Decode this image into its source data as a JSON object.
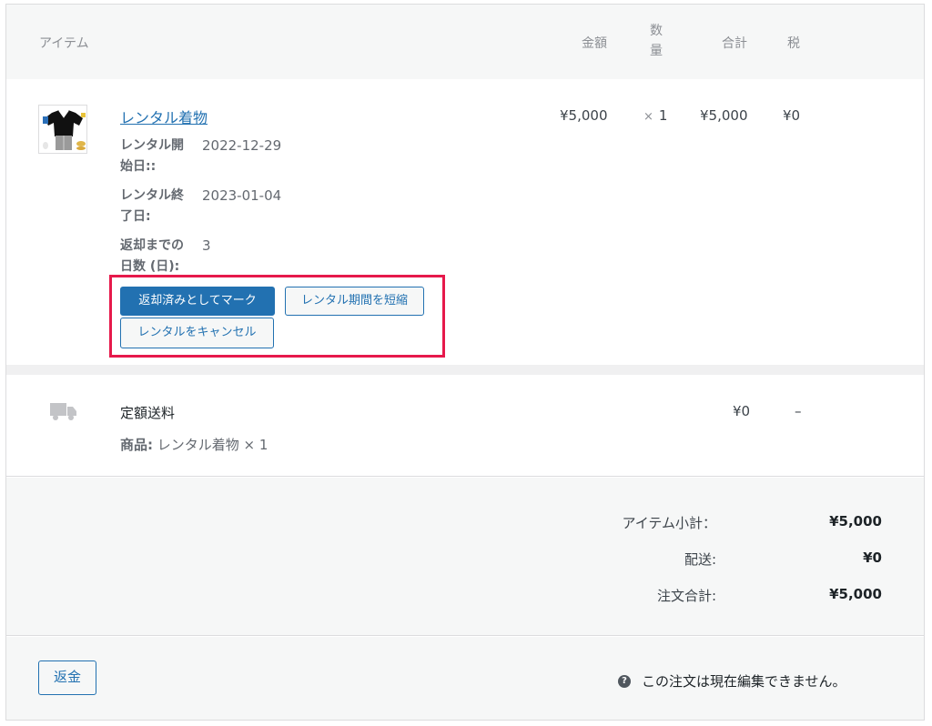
{
  "columns": {
    "item": "アイテム",
    "cost": "金額",
    "qty_line1": "数",
    "qty_line2": "量",
    "total": "合計",
    "tax": "税"
  },
  "line_item": {
    "name": "レンタル着物",
    "meta": [
      {
        "label": "レンタル開始日::",
        "value": "2022-12-29"
      },
      {
        "label": "レンタル終了日:",
        "value": "2023-01-04"
      },
      {
        "label": "返却までの日数 (日):",
        "value": "3"
      }
    ],
    "cost": "¥5,000",
    "qty_prefix": "×",
    "qty": "1",
    "total": "¥5,000",
    "tax": "¥0",
    "actions": {
      "mark_returned": "返却済みとしてマーク",
      "shorten_period": "レンタル期間を短縮",
      "cancel_rental": "レンタルをキャンセル"
    }
  },
  "shipping": {
    "name": "定額送料",
    "items_label": "商品:",
    "items_value": "レンタル着物 × 1",
    "total": "¥0",
    "tax": "–"
  },
  "totals": {
    "subtotal_label": "アイテム小計：",
    "subtotal_value": "¥5,000",
    "shipping_label": "配送:",
    "shipping_value": "¥0",
    "order_total_label": "注文合計:",
    "order_total_value": "¥5,000"
  },
  "footer": {
    "refund_button": "返金",
    "help_icon": "question-circle-icon",
    "note": "この注文は現在編集できません。"
  },
  "colors": {
    "primary": "#2271b1",
    "highlight_border": "#e6194b",
    "panel_bg": "#f6f7f7"
  }
}
